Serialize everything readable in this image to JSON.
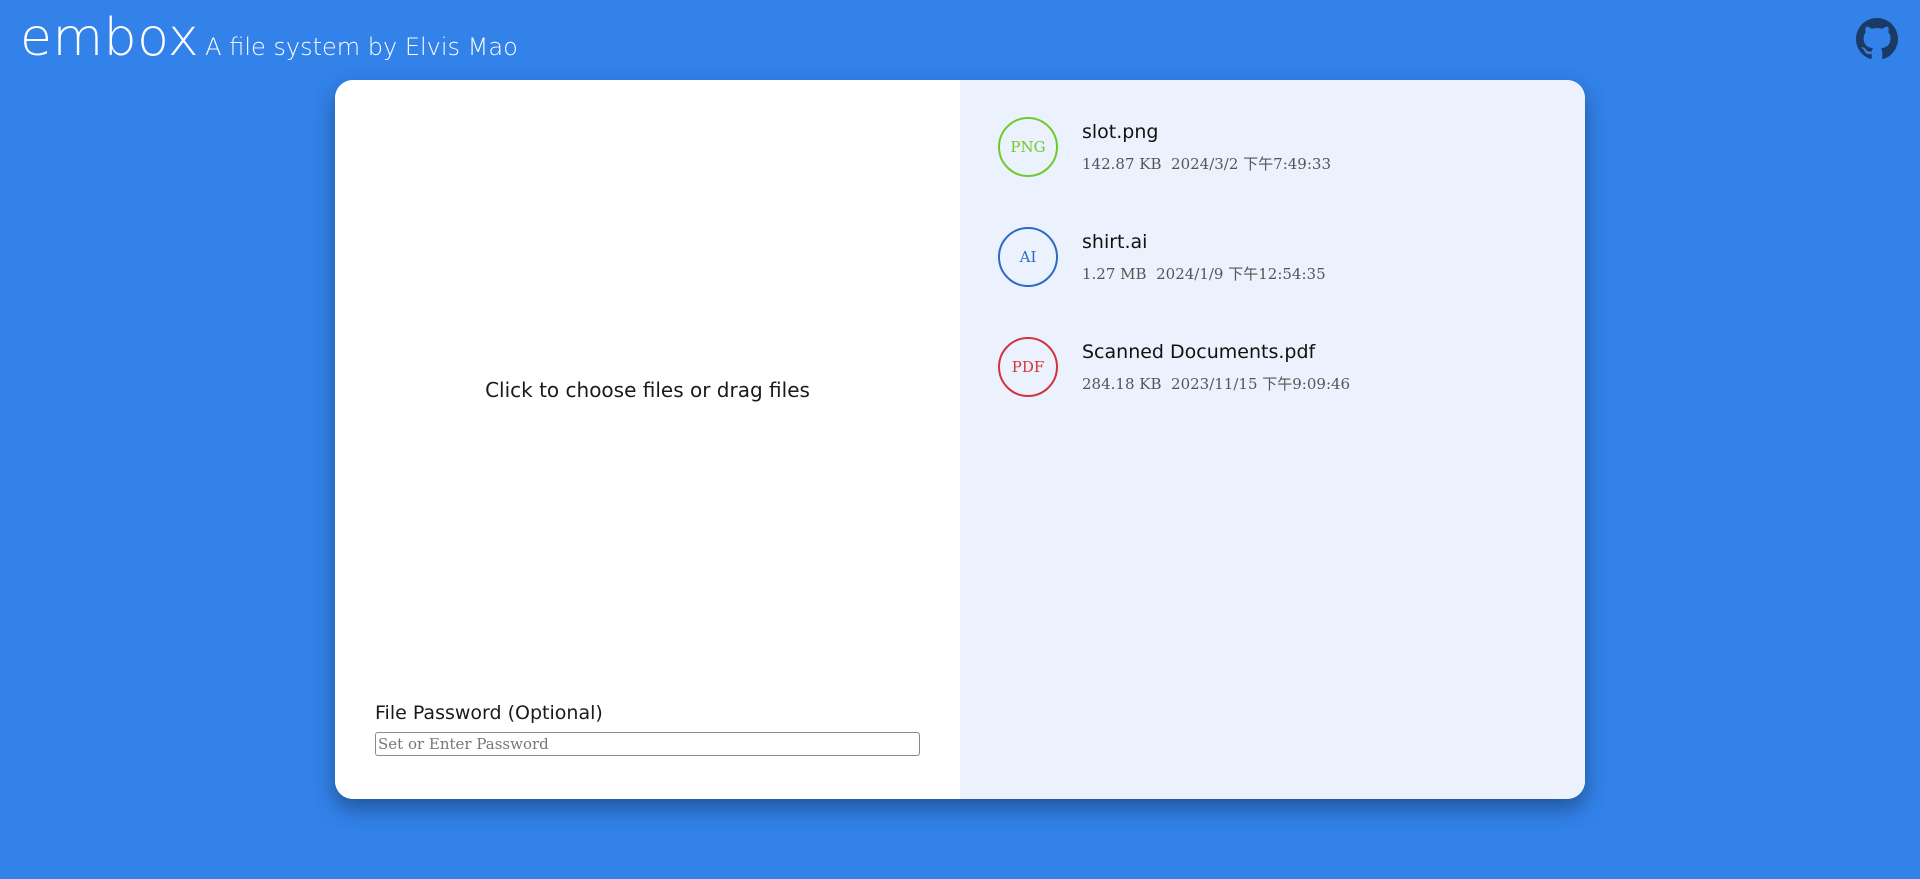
{
  "header": {
    "brand": "embox",
    "tagline": "A file system by Elvis Mao"
  },
  "upload": {
    "dropzone_text": "Click to choose files or drag files",
    "password_label": "File Password (Optional)",
    "password_placeholder": "Set or Enter Password",
    "password_value": ""
  },
  "files": [
    {
      "badge": "PNG",
      "badge_color": "#6ecb2a",
      "name": "slot.png",
      "size": "142.87 KB",
      "date": "2024/3/2 下午7:49:33"
    },
    {
      "badge": "AI",
      "badge_color": "#2e6ac4",
      "name": "shirt.ai",
      "size": "1.27 MB",
      "date": "2024/1/9 下午12:54:35"
    },
    {
      "badge": "PDF",
      "badge_color": "#d4333b",
      "name": "Scanned Documents.pdf",
      "size": "284.18 KB",
      "date": "2023/11/15 下午9:09:46"
    }
  ],
  "colors": {
    "background": "#3282ea",
    "card": "#ffffff",
    "file_panel": "#ebf2fd"
  },
  "icons": {
    "github": "github-icon"
  }
}
